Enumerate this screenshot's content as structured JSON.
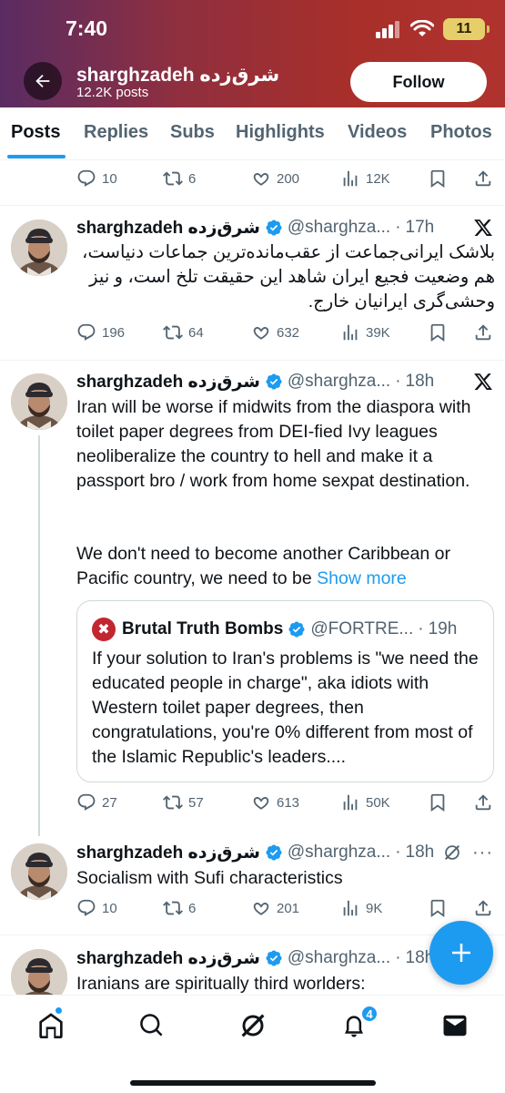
{
  "status_bar": {
    "time": "7:40",
    "battery": "11"
  },
  "profile": {
    "name": "sharghzadeh شرق‌زده",
    "posts_count": "12.2K posts",
    "follow_label": "Follow"
  },
  "tabs": [
    "Posts",
    "Replies",
    "Subs",
    "Highlights",
    "Videos",
    "Photos"
  ],
  "tweets": [
    {
      "stats": {
        "replies": "10",
        "reposts": "6",
        "likes": "200",
        "views": "12K"
      }
    },
    {
      "name": "sharghzadeh شرق‌زده",
      "handle": "@sharghza...",
      "time": "17h",
      "text": "بلاشک ایرانی‌جماعت از عقب‌مانده‌ترین جماعات دنیاست، هم وضعیت فجیع ایران شاهد این حقیقت تلخ است، و نیز وحشی‌گری ایرانیان خارج.",
      "stats": {
        "replies": "196",
        "reposts": "64",
        "likes": "632",
        "views": "39K"
      }
    },
    {
      "name": "sharghzadeh شرق‌زده",
      "handle": "@sharghza...",
      "time": "18h",
      "text_p1": "Iran will be worse if midwits from the diaspora with toilet paper degrees from DEI-fied Ivy leagues neoliberalize the country to hell and make it a passport bro / work from home sexpat destination.",
      "text_p2": "We don't need to become another Caribbean or Pacific country, we need to be",
      "show_more": "Show more",
      "quote": {
        "name": "Brutal Truth Bombs",
        "handle": "@FORTRE...",
        "time": "19h",
        "text": "If your solution to Iran's problems is \"we need the educated people in charge\", aka idiots with Western toilet paper degrees, then congratulations, you're 0% different from most of the Islamic Republic's leaders...."
      },
      "stats": {
        "replies": "27",
        "reposts": "57",
        "likes": "613",
        "views": "50K"
      }
    },
    {
      "name": "sharghzadeh شرق‌زده",
      "handle": "@sharghza...",
      "time": "18h",
      "text": "Socialism with Sufi characteristics",
      "stats": {
        "replies": "10",
        "reposts": "6",
        "likes": "201",
        "views": "9K"
      }
    },
    {
      "name": "sharghzadeh شرق‌زده",
      "handle": "@sharghza...",
      "time": "18h",
      "text": "Iranians are spiritually third worlders:"
    }
  ],
  "nav": {
    "notifications_badge": "4"
  },
  "colors": {
    "accent": "#1d9bf0",
    "text": "#0f1419",
    "muted": "#536471",
    "header_red": "#a82f2a"
  }
}
